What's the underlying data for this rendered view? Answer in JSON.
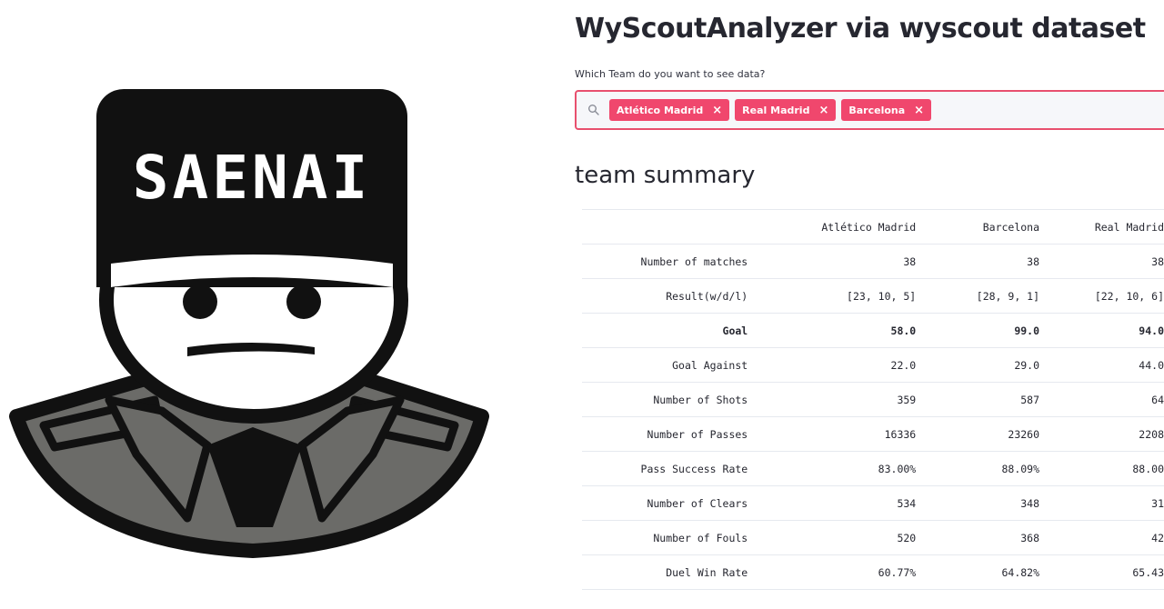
{
  "logo": {
    "text": "SAENAI"
  },
  "app": {
    "title": "WyScoutAnalyzer via wyscout dataset",
    "team_select": {
      "label": "Which Team do you want to see data?",
      "selected": [
        "Atlético Madrid",
        "Real Madrid",
        "Barcelona"
      ],
      "remove_icon": "×"
    },
    "summary_title": "team summary",
    "table": {
      "headers": [
        "",
        "Atlético Madrid",
        "Barcelona",
        "Real Madrid"
      ],
      "rows": [
        [
          "Number of matches",
          "38",
          "38",
          "38"
        ],
        [
          "Result(w/d/l)",
          "[23, 10, 5]",
          "[28, 9, 1]",
          "[22, 10, 6]"
        ],
        [
          "Goal",
          "58.0",
          "99.0",
          "94.0"
        ],
        [
          "Goal Against",
          "22.0",
          "29.0",
          "44.0"
        ],
        [
          "Number of Shots",
          "359",
          "587",
          "64"
        ],
        [
          "Number of Passes",
          "16336",
          "23260",
          "2208"
        ],
        [
          "Pass Success Rate",
          "83.00%",
          "88.09%",
          "88.00"
        ],
        [
          "Number of Clears",
          "534",
          "348",
          "31"
        ],
        [
          "Number of Fouls",
          "520",
          "368",
          "42"
        ],
        [
          "Duel Win Rate",
          "60.77%",
          "64.82%",
          "65.43"
        ]
      ]
    }
  },
  "colors": {
    "accent": "#f0476d",
    "border_accent": "#e8506e",
    "coat": "#6b6b68",
    "ink": "#111111"
  }
}
